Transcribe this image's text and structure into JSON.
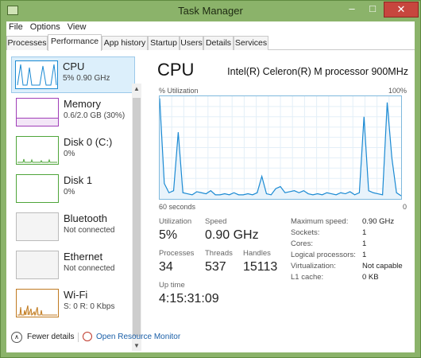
{
  "window": {
    "title": "Task Manager"
  },
  "menu": [
    "File",
    "Options",
    "View"
  ],
  "tabs": [
    "Processes",
    "Performance",
    "App history",
    "Startup",
    "Users",
    "Details",
    "Services"
  ],
  "sidebar": {
    "items": [
      {
        "name": "CPU",
        "value": "5% 0.90 GHz",
        "color": "#1b8ad3",
        "icon": "cpu-sparkline"
      },
      {
        "name": "Memory",
        "value": "0.6/2.0 GB (30%)",
        "color": "#a03fb8",
        "icon": "memory-graph"
      },
      {
        "name": "Disk 0 (C:)",
        "value": "0%",
        "color": "#4fa53a",
        "icon": "disk-graph"
      },
      {
        "name": "Disk 1",
        "value": "0%",
        "color": "#4fa53a",
        "icon": "disk-graph"
      },
      {
        "name": "Bluetooth",
        "value": "Not connected",
        "color": "#999999",
        "icon": "bluetooth-graph"
      },
      {
        "name": "Ethernet",
        "value": "Not connected",
        "color": "#999999",
        "icon": "ethernet-graph"
      },
      {
        "name": "Wi-Fi",
        "value": "S: 0 R: 0 Kbps",
        "color": "#c07a20",
        "icon": "wifi-graph"
      }
    ]
  },
  "cpu": {
    "title": "CPU",
    "model": "Intel(R) Celeron(R) M processor 900MHz",
    "util_label": "% Utilization",
    "util_max": "100%",
    "graph_min": "60 seconds",
    "graph_zero": "0",
    "series": [
      98,
      15,
      6,
      8,
      65,
      6,
      5,
      4,
      7,
      6,
      5,
      8,
      4,
      4,
      5,
      4,
      6,
      4,
      4,
      5,
      4,
      6,
      22,
      5,
      4,
      10,
      12,
      6,
      7,
      8,
      6,
      8,
      5,
      4,
      5,
      4,
      6,
      5,
      4,
      6,
      5,
      7,
      4,
      6,
      80,
      8,
      6,
      5,
      4,
      94,
      40,
      6,
      3
    ],
    "stats": {
      "utilization_label": "Utilization",
      "utilization": "5%",
      "speed_label": "Speed",
      "speed": "0.90 GHz",
      "processes_label": "Processes",
      "processes": "34",
      "threads_label": "Threads",
      "threads": "537",
      "handles_label": "Handles",
      "handles": "15113",
      "uptime_label": "Up time",
      "uptime": "4:15:31:09"
    },
    "details": [
      {
        "label": "Maximum speed:",
        "value": "0.90 GHz"
      },
      {
        "label": "Sockets:",
        "value": "1"
      },
      {
        "label": "Cores:",
        "value": "1"
      },
      {
        "label": "Logical processors:",
        "value": "1"
      },
      {
        "label": "Virtualization:",
        "value": "Not capable"
      },
      {
        "label": "L1 cache:",
        "value": "0 KB"
      }
    ]
  },
  "footer": {
    "fewer": "Fewer details",
    "resource_monitor": "Open Resource Monitor"
  }
}
